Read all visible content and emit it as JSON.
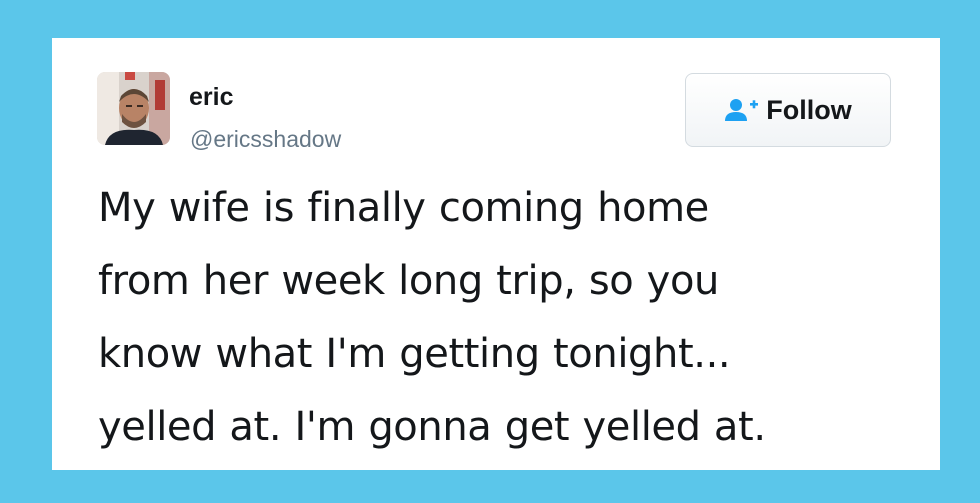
{
  "tweet": {
    "author": {
      "display_name": "eric",
      "handle": "@ericsshadow"
    },
    "follow_button": {
      "label": "Follow",
      "icon": "add-user-icon"
    },
    "text_lines": [
      "My wife is finally coming home",
      "from her week long trip, so you",
      "know what I'm getting tonight...",
      "yelled at. I'm gonna get yelled at."
    ]
  },
  "colors": {
    "background": "#5bc6ea",
    "card": "#ffffff",
    "primary_text": "#14171a",
    "secondary_text": "#657786",
    "follow_icon": "#1da1f2"
  }
}
